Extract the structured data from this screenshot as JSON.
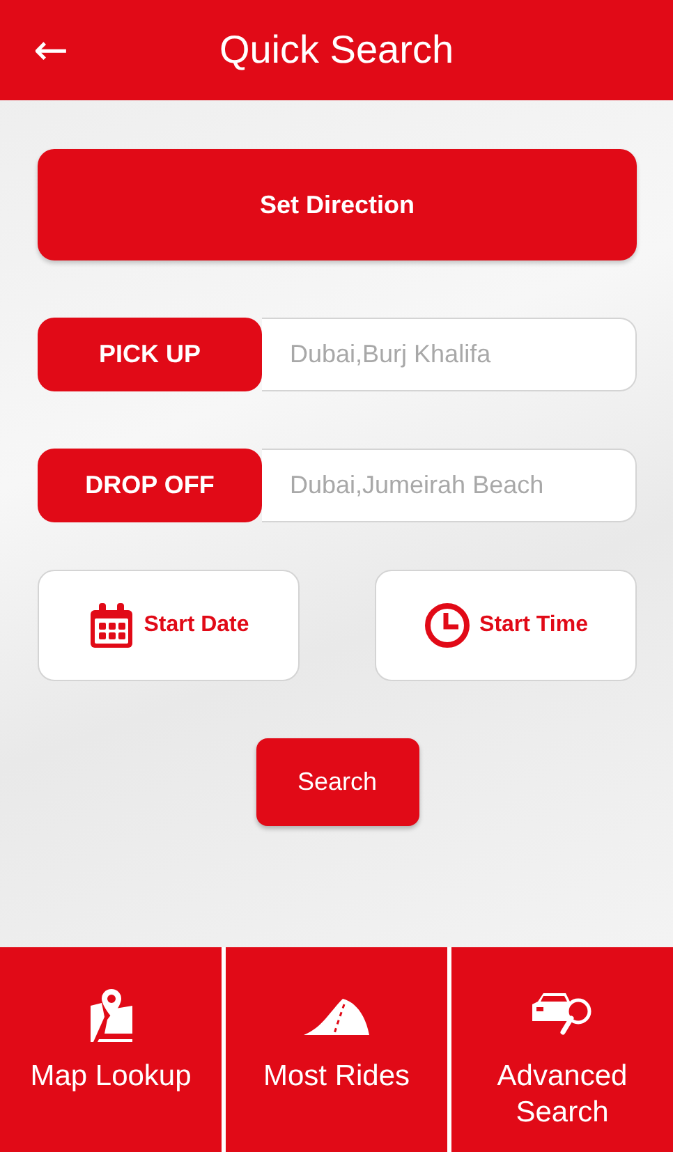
{
  "header": {
    "back": "←",
    "title": "Quick Search"
  },
  "direction_button": "Set Direction",
  "locations": [
    {
      "label": "PICK UP",
      "placeholder": "Dubai,Burj Khalifa"
    },
    {
      "label": "DROP OFF",
      "placeholder": "Dubai,Jumeirah Beach"
    }
  ],
  "pickers": [
    "Start Date",
    "Start Time"
  ],
  "search_button": "Search",
  "bottom_nav": [
    "Map Lookup",
    "Most Rides",
    "Advanced Search"
  ]
}
